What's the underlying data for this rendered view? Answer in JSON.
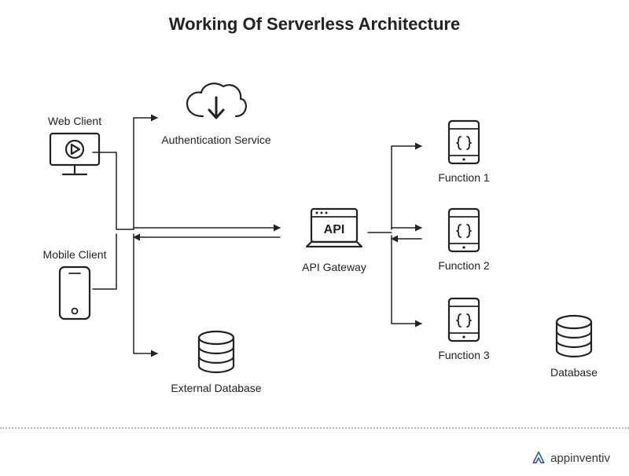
{
  "title": "Working Of Serverless Architecture",
  "nodes": {
    "web_client": "Web Client",
    "mobile_client": "Mobile Client",
    "auth_service": "Authentication Service",
    "external_db": "External Database",
    "api_gateway": "API Gateway",
    "api_gateway_badge": "API",
    "function_1": "Function 1",
    "function_2": "Function 2",
    "function_3": "Function 3",
    "database": "Database"
  },
  "brand": "appinventiv"
}
